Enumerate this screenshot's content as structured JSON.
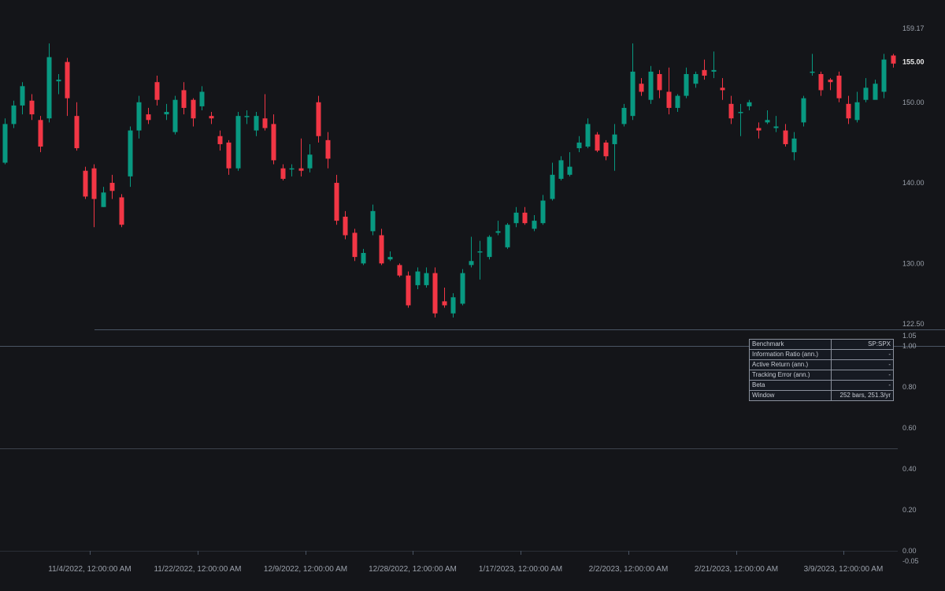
{
  "chart_data": [
    {
      "type": "candlestick",
      "price_axis": {
        "range": [
          122.5,
          159.17
        ],
        "ticks": [
          "159.17",
          "150.00",
          "140.00",
          "130.00",
          "122.50"
        ],
        "last_price": "155.00"
      },
      "x_ticks": [
        "11/4/2022, 12:00:00 AM",
        "11/22/2022, 12:00:00 AM",
        "12/9/2022, 12:00:00 AM",
        "12/28/2022, 12:00:00 AM",
        "1/17/2023, 12:00:00 AM",
        "2/2/2023, 12:00:00 AM",
        "2/21/2023, 12:00:00 AM",
        "3/9/2023, 12:00:00 AM"
      ],
      "colors": {
        "up": "#089981",
        "down": "#f23645"
      },
      "candles": [
        [
          142.5,
          147.3,
          148.0,
          142.3
        ],
        [
          147.3,
          149.6,
          150.2,
          146.8
        ],
        [
          149.6,
          152.0,
          152.5,
          148.5
        ],
        [
          150.2,
          148.5,
          151.0,
          147.8
        ],
        [
          147.8,
          144.5,
          148.3,
          143.8
        ],
        [
          148.0,
          155.6,
          157.3,
          147.5
        ],
        [
          152.6,
          152.8,
          153.5,
          151.0
        ],
        [
          155.0,
          150.5,
          155.5,
          148.3
        ],
        [
          148.3,
          144.3,
          150.0,
          144.0
        ],
        [
          141.5,
          138.3,
          142.0,
          138.0
        ],
        [
          141.8,
          138.0,
          142.3,
          134.5
        ],
        [
          137.0,
          138.8,
          139.5,
          137.0
        ],
        [
          140.0,
          139.0,
          141.0,
          138.0
        ],
        [
          138.2,
          134.8,
          138.6,
          134.5
        ],
        [
          140.8,
          146.5,
          147.0,
          139.5
        ],
        [
          146.5,
          150.0,
          150.8,
          145.5
        ],
        [
          148.5,
          147.8,
          149.3,
          147.3
        ],
        [
          152.5,
          150.3,
          153.3,
          149.6
        ],
        [
          148.5,
          148.8,
          149.8,
          147.8
        ],
        [
          146.3,
          150.3,
          150.8,
          146.0
        ],
        [
          151.5,
          149.3,
          152.5,
          148.5
        ],
        [
          150.3,
          148.0,
          150.5,
          147.0
        ],
        [
          149.5,
          151.3,
          152.0,
          149.0
        ],
        [
          148.3,
          148.0,
          148.8,
          147.3
        ],
        [
          145.8,
          144.8,
          146.5,
          144.0
        ],
        [
          145.0,
          141.8,
          145.3,
          141.0
        ],
        [
          141.8,
          148.3,
          148.8,
          141.5
        ],
        [
          148.3,
          148.3,
          149.0,
          147.3
        ],
        [
          146.5,
          148.3,
          148.8,
          145.8
        ],
        [
          148.0,
          146.8,
          151.0,
          146.5
        ],
        [
          147.3,
          142.8,
          148.5,
          142.3
        ],
        [
          141.8,
          140.5,
          142.3,
          140.3
        ],
        [
          141.8,
          141.8,
          142.3,
          140.8
        ],
        [
          141.8,
          141.5,
          145.5,
          140.8
        ],
        [
          141.8,
          143.5,
          144.8,
          141.3
        ],
        [
          150.0,
          145.8,
          150.8,
          145.0
        ],
        [
          145.3,
          143.0,
          146.3,
          141.8
        ],
        [
          140.0,
          135.3,
          141.0,
          134.8
        ],
        [
          135.8,
          133.5,
          136.5,
          133.0
        ],
        [
          133.8,
          130.8,
          134.3,
          130.3
        ],
        [
          130.0,
          131.3,
          131.8,
          129.8
        ],
        [
          134.0,
          136.5,
          137.3,
          133.5
        ],
        [
          133.5,
          130.0,
          134.3,
          129.8
        ],
        [
          130.5,
          130.8,
          131.5,
          130.3
        ],
        [
          129.8,
          128.5,
          130.0,
          128.3
        ],
        [
          128.5,
          124.8,
          129.0,
          124.5
        ],
        [
          127.3,
          129.0,
          129.5,
          126.8
        ],
        [
          127.3,
          128.8,
          129.5,
          127.0
        ],
        [
          128.8,
          123.8,
          129.5,
          123.3
        ],
        [
          125.3,
          124.8,
          127.0,
          124.5
        ],
        [
          123.8,
          125.8,
          126.3,
          123.3
        ],
        [
          125.0,
          128.8,
          129.3,
          124.8
        ],
        [
          129.8,
          130.3,
          133.3,
          129.5
        ],
        [
          131.5,
          131.5,
          132.8,
          128.0
        ],
        [
          130.8,
          133.3,
          133.5,
          130.5
        ],
        [
          133.8,
          134.0,
          135.3,
          133.5
        ],
        [
          132.0,
          134.8,
          135.0,
          131.8
        ],
        [
          135.0,
          136.3,
          137.0,
          134.5
        ],
        [
          136.3,
          135.0,
          137.0,
          134.8
        ],
        [
          134.3,
          135.3,
          136.0,
          134.0
        ],
        [
          135.0,
          137.8,
          138.5,
          134.8
        ],
        [
          138.0,
          141.0,
          142.5,
          137.8
        ],
        [
          140.5,
          142.8,
          143.3,
          140.3
        ],
        [
          141.0,
          142.0,
          143.8,
          140.8
        ],
        [
          144.3,
          145.0,
          145.8,
          143.8
        ],
        [
          144.5,
          147.3,
          148.0,
          144.3
        ],
        [
          146.0,
          144.0,
          146.3,
          143.8
        ],
        [
          145.0,
          143.3,
          145.3,
          142.8
        ],
        [
          144.8,
          146.0,
          147.3,
          141.5
        ],
        [
          147.3,
          149.3,
          149.8,
          147.0
        ],
        [
          148.3,
          153.8,
          157.3,
          147.8
        ],
        [
          152.3,
          151.3,
          153.0,
          150.8
        ],
        [
          150.3,
          153.8,
          154.5,
          149.8
        ],
        [
          153.5,
          151.5,
          154.0,
          150.5
        ],
        [
          151.3,
          149.3,
          154.3,
          148.5
        ],
        [
          149.3,
          150.8,
          151.0,
          148.8
        ],
        [
          150.8,
          153.5,
          154.3,
          150.5
        ],
        [
          152.3,
          153.5,
          153.8,
          151.8
        ],
        [
          154.0,
          153.3,
          155.3,
          152.8
        ],
        [
          153.8,
          154.0,
          156.3,
          153.0
        ],
        [
          151.8,
          151.5,
          153.0,
          150.3
        ],
        [
          149.8,
          148.0,
          150.8,
          147.3
        ],
        [
          148.8,
          148.8,
          149.8,
          145.8
        ],
        [
          149.5,
          150.0,
          150.3,
          149.0
        ],
        [
          146.8,
          146.5,
          147.5,
          145.5
        ],
        [
          147.5,
          147.8,
          149.0,
          147.3
        ],
        [
          146.8,
          147.0,
          148.3,
          146.3
        ],
        [
          146.5,
          144.8,
          147.3,
          144.5
        ],
        [
          143.8,
          145.5,
          146.3,
          142.8
        ],
        [
          147.5,
          150.5,
          150.8,
          147.0
        ],
        [
          153.8,
          153.8,
          156.0,
          153.3
        ],
        [
          153.5,
          151.5,
          153.8,
          150.8
        ],
        [
          152.8,
          152.5,
          153.0,
          151.5
        ],
        [
          153.3,
          150.5,
          153.8,
          150.0
        ],
        [
          149.8,
          148.0,
          150.8,
          147.3
        ],
        [
          147.8,
          150.0,
          151.3,
          147.5
        ],
        [
          150.3,
          151.8,
          153.0,
          150.0
        ],
        [
          150.3,
          152.3,
          152.8,
          151.0
        ],
        [
          151.3,
          155.3,
          156.0,
          150.5
        ],
        [
          155.8,
          154.8,
          156.0,
          154.3
        ]
      ]
    },
    {
      "type": "line",
      "y_axis": {
        "range": [
          -0.05,
          1.05
        ],
        "ticks": [
          "1.05",
          "1.00",
          "0.80",
          "0.60",
          "0.40",
          "0.20",
          "0.00",
          "-0.05"
        ]
      },
      "lines": [
        {
          "y": 1.0
        },
        {
          "y": 0.5
        },
        {
          "y": 0.0
        }
      ]
    }
  ],
  "stats_table": {
    "rows": [
      {
        "label": "Benchmark",
        "value": "SP:SPX"
      },
      {
        "label": "Information Ratio (ann.)",
        "value": "-"
      },
      {
        "label": "Active Return (ann.)",
        "value": "-"
      },
      {
        "label": "Tracking Error (ann.)",
        "value": "-"
      },
      {
        "label": "Beta",
        "value": "-"
      },
      {
        "label": "Window",
        "value": "252 bars, 251.3/yr"
      }
    ]
  }
}
